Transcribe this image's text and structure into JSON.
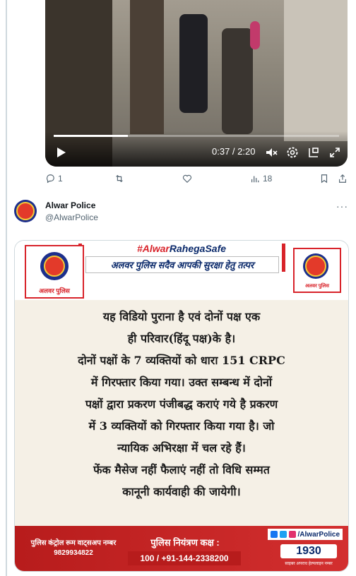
{
  "video": {
    "time": "0:37 / 2:20",
    "progress_fraction": 0.26
  },
  "actions": {
    "replies": "1",
    "views": "18"
  },
  "author": {
    "name": "Alwar Police",
    "handle": "@AlwarPolice",
    "more": "···"
  },
  "poster": {
    "hashtag_a": "#Alwar",
    "hashtag_b": "RahegaSafe",
    "tagline": "अलवर पुलिस सदैव आपकी सुरक्षा हेतु तत्पर",
    "logo_label_left": "अलवर पुलिस",
    "logo_label_right": "अलवर पुलिस",
    "lines": [
      "यह विडियो पुराना है एवं दोनों पक्ष एक",
      "ही परिवार(हिंदू पक्ष)के है।",
      "दोनों पक्षों के 7 व्यक्तियों को धारा 151 CRPC",
      "में गिरफ्तार किया गया। उक्त सम्बन्ध में दोनों",
      "पक्षों द्वारा प्रकरण पंजीबद्ध कराएं गये है प्रकरण",
      "में 3 व्यक्तियों को गिरफ्तार किया गया है। जो",
      "न्यायिक अभिरक्षा में चल रहे हैं।",
      "फेंक मैसेज नहीं फैलाएं नहीं तो विधि सम्मत",
      "कानूनी कार्यवाही की जायेगी।"
    ],
    "bottom": {
      "left_line1": "पुलिस कंट्रोल रूम वाट्सअप नम्बर",
      "left_line2": "9829934822",
      "mid_title": "पुलिस नियंत्रण कक्ष :",
      "mid_numbers": "100 / +91-144-2338200",
      "social_handle": "/AlwarPolice",
      "helpline": "1930",
      "helpline_sub": "साइबर अपराध हेल्पलाइन नम्बर"
    }
  },
  "colors": {
    "accent_red": "#d8232a",
    "navy": "#0b2a6b",
    "muted": "#536471"
  }
}
